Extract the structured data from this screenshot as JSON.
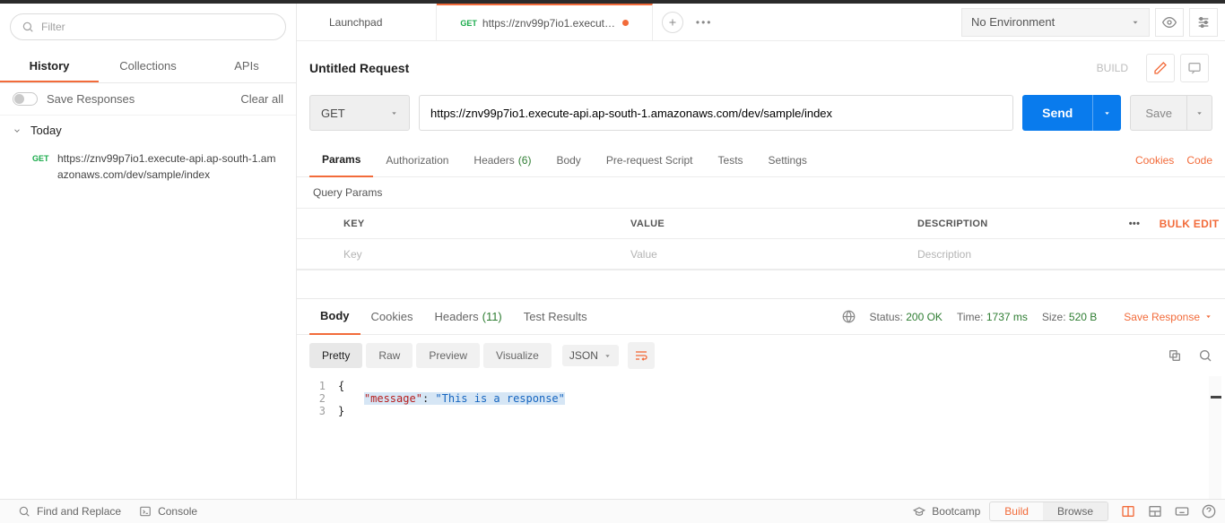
{
  "sidebar": {
    "filter_placeholder": "Filter",
    "tabs": {
      "history": "History",
      "collections": "Collections",
      "apis": "APIs"
    },
    "save_responses": "Save Responses",
    "clear_all": "Clear all",
    "today": "Today",
    "history": [
      {
        "method": "GET",
        "url": "https://znv99p7io1.execute-api.ap-south-1.amazonaws.com/dev/sample/index"
      }
    ]
  },
  "tabs": {
    "launchpad": "Launchpad",
    "active": {
      "method": "GET",
      "label": "https://znv99p7io1.execute-api...."
    }
  },
  "env": {
    "label": "No Environment"
  },
  "request": {
    "title": "Untitled Request",
    "build": "BUILD",
    "method": "GET",
    "url": "https://znv99p7io1.execute-api.ap-south-1.amazonaws.com/dev/sample/index",
    "send": "Send",
    "save": "Save",
    "tabs": {
      "params": "Params",
      "auth": "Authorization",
      "headers": "Headers",
      "headers_count": "(6)",
      "body": "Body",
      "prereq": "Pre-request Script",
      "tests": "Tests",
      "settings": "Settings"
    },
    "cookies_link": "Cookies",
    "code_link": "Code",
    "qp_title": "Query Params",
    "cols": {
      "key": "KEY",
      "value": "VALUE",
      "desc": "DESCRIPTION"
    },
    "bulk_edit": "Bulk Edit",
    "ph": {
      "key": "Key",
      "value": "Value",
      "desc": "Description"
    }
  },
  "response": {
    "tabs": {
      "body": "Body",
      "cookies": "Cookies",
      "headers": "Headers",
      "headers_count": "(11)",
      "test_results": "Test Results"
    },
    "status_lbl": "Status:",
    "status_val": "200 OK",
    "time_lbl": "Time:",
    "time_val": "1737 ms",
    "size_lbl": "Size:",
    "size_val": "520 B",
    "save_response": "Save Response",
    "view": {
      "pretty": "Pretty",
      "raw": "Raw",
      "preview": "Preview",
      "visualize": "Visualize",
      "fmt": "JSON"
    },
    "body_lines": [
      {
        "n": "1",
        "text": "{"
      },
      {
        "n": "2",
        "key": "\"message\"",
        "colon": ": ",
        "val": "\"This is a response\""
      },
      {
        "n": "3",
        "text": "}"
      }
    ]
  },
  "footer": {
    "find_replace": "Find and Replace",
    "console": "Console",
    "bootcamp": "Bootcamp",
    "build": "Build",
    "browse": "Browse"
  }
}
